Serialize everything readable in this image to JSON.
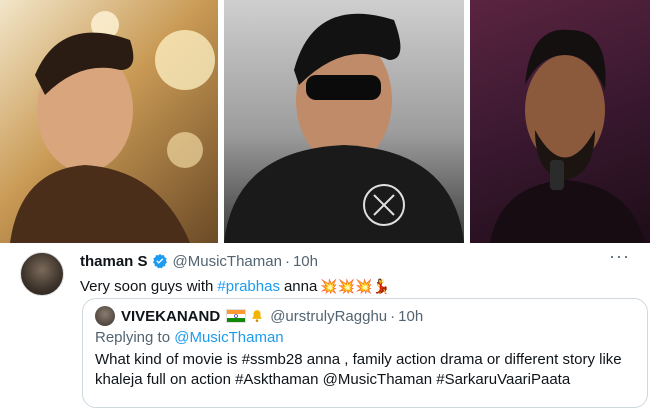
{
  "tweet": {
    "display_name": "thaman S",
    "handle": "@MusicThaman",
    "separator": "·",
    "time": "10h",
    "text_before": "Very soon guys with",
    "hashtag": "#prabhas",
    "text_after": "anna",
    "emojis": "💥💥💥💃",
    "more_label": "···"
  },
  "quote": {
    "display_name": "VIVEKANAND",
    "handle": "@urstrulyRagghu",
    "separator": "·",
    "time": "10h",
    "replying_prefix": "Replying to",
    "replying_to": "@MusicThaman",
    "text": "What kind of movie is #ssmb28 anna , family action drama or different story like khaleja full on action #Askthaman @MusicThaman #SarkaruVaariPaata"
  },
  "colors": {
    "link": "#1d9bf0",
    "muted": "#536471",
    "text": "#0f1419",
    "border": "#cfd9de"
  }
}
